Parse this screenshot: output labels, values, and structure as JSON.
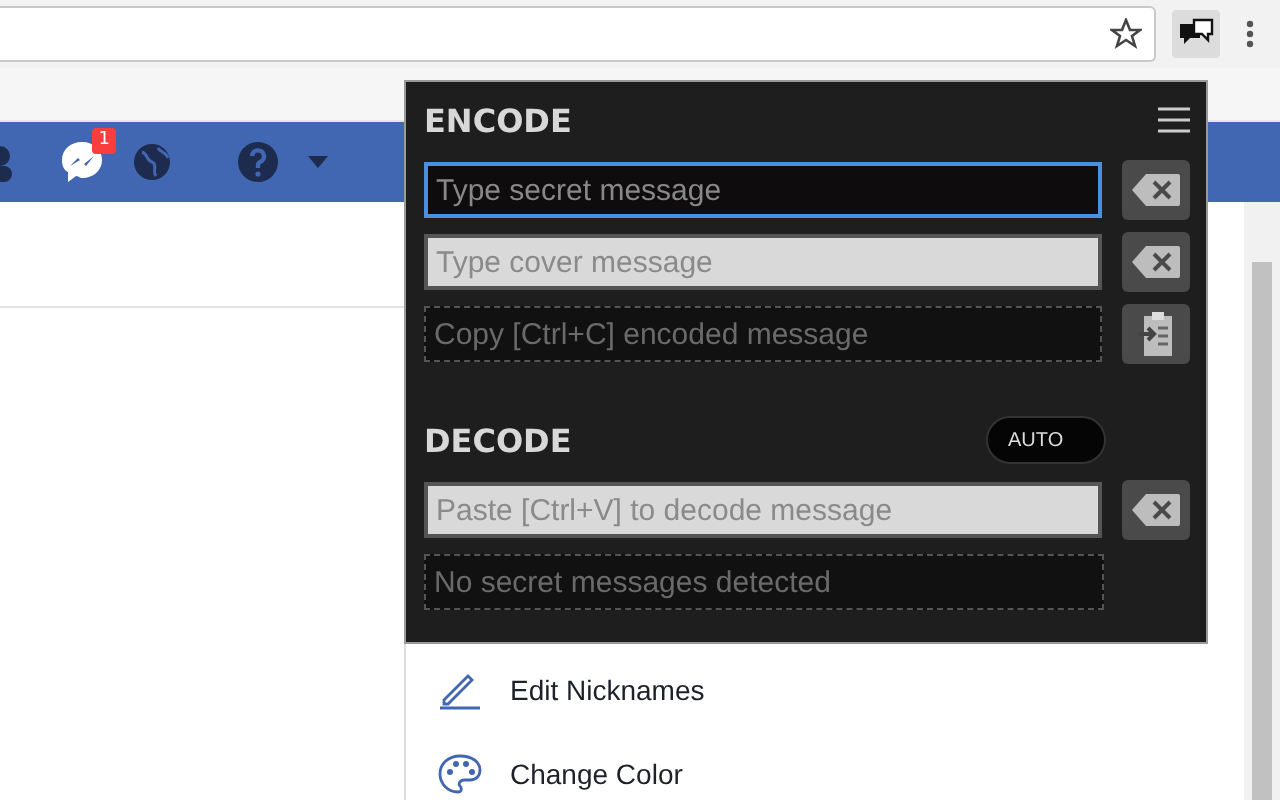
{
  "browser": {
    "notification_count": "1"
  },
  "popup": {
    "encode": {
      "title": "ENCODE",
      "fields": [
        {
          "kind": "input",
          "placeholder": "Type secret message",
          "focused": true,
          "button": {
            "kind": "clear"
          }
        },
        {
          "kind": "input",
          "placeholder": "Type cover message",
          "focused": false,
          "button": {
            "kind": "clear"
          }
        },
        {
          "kind": "output",
          "placeholder": "Copy [Ctrl+C] encoded message",
          "button": {
            "kind": "copy"
          }
        }
      ]
    },
    "decode": {
      "title": "DECODE",
      "toggle": {
        "label": "AUTO",
        "on": true
      },
      "fields": [
        {
          "kind": "input",
          "placeholder": "Paste [Ctrl+V] to decode message",
          "focused": false,
          "button": {
            "kind": "clear"
          }
        },
        {
          "kind": "output",
          "placeholder": "No secret messages detected"
        }
      ]
    }
  },
  "menu": {
    "items": [
      {
        "kind": "pencil",
        "label": "Edit Nicknames"
      },
      {
        "kind": "palette",
        "label": "Change Color"
      }
    ]
  }
}
